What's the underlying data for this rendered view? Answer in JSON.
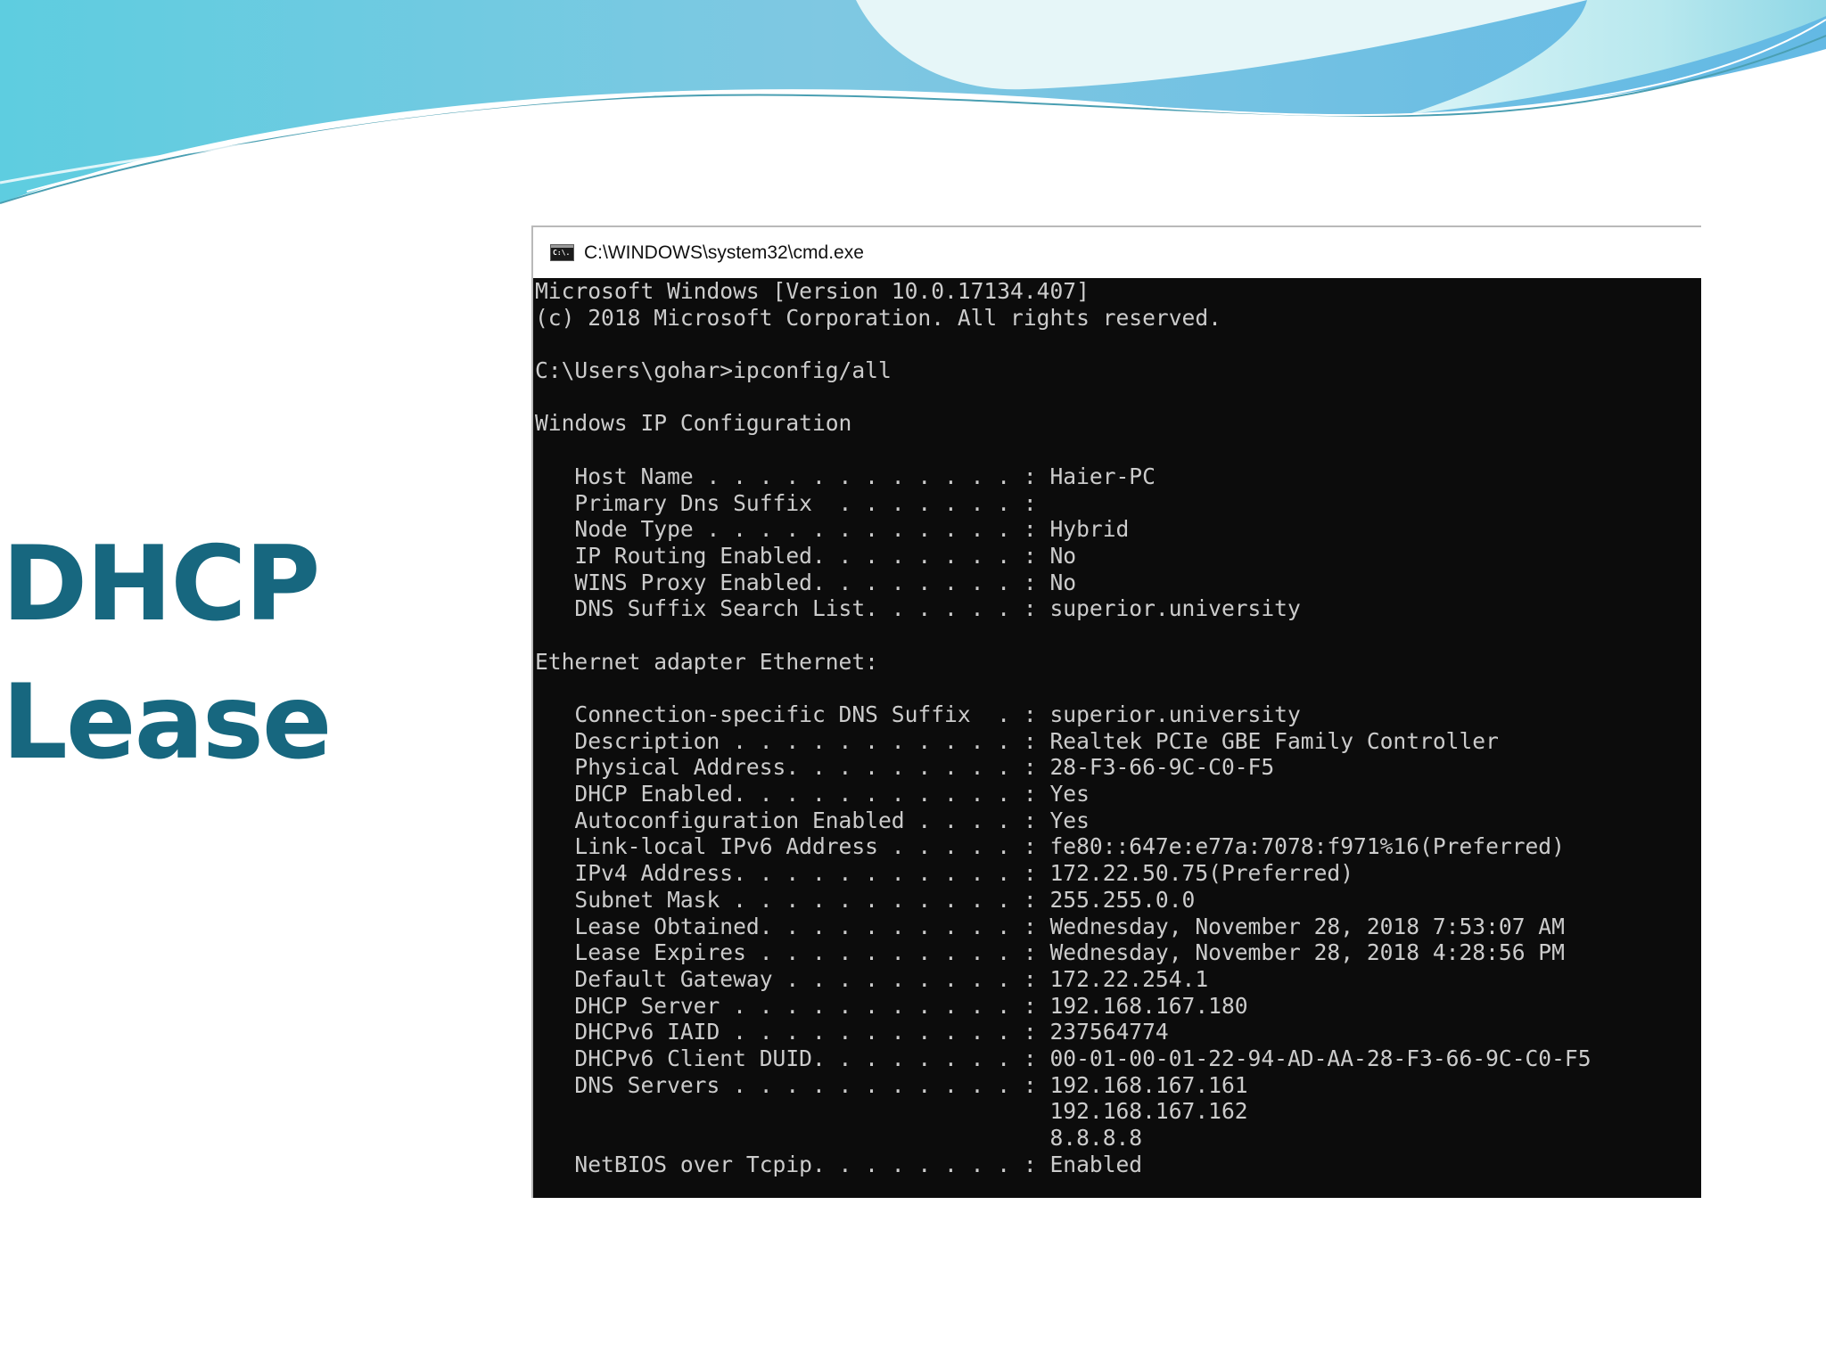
{
  "slide": {
    "title_line_1": "DHCP",
    "title_line_2": "Lease",
    "title_color": "#17677f"
  },
  "window": {
    "icon": "cmd-icon",
    "icon_text": "C:\\.",
    "title": "C:\\WINDOWS\\system32\\cmd.exe",
    "console_background": "#0c0c0c",
    "console_text_color": "#cccccc"
  },
  "console": {
    "lines": [
      "Microsoft Windows [Version 10.0.17134.407]",
      "(c) 2018 Microsoft Corporation. All rights reserved.",
      "",
      "C:\\Users\\gohar>ipconfig/all",
      "",
      "Windows IP Configuration",
      "",
      "   Host Name . . . . . . . . . . . . : Haier-PC",
      "   Primary Dns Suffix  . . . . . . . :",
      "   Node Type . . . . . . . . . . . . : Hybrid",
      "   IP Routing Enabled. . . . . . . . : No",
      "   WINS Proxy Enabled. . . . . . . . : No",
      "   DNS Suffix Search List. . . . . . : superior.university",
      "",
      "Ethernet adapter Ethernet:",
      "",
      "   Connection-specific DNS Suffix  . : superior.university",
      "   Description . . . . . . . . . . . : Realtek PCIe GBE Family Controller",
      "   Physical Address. . . . . . . . . : 28-F3-66-9C-C0-F5",
      "   DHCP Enabled. . . . . . . . . . . : Yes",
      "   Autoconfiguration Enabled . . . . : Yes",
      "   Link-local IPv6 Address . . . . . : fe80::647e:e77a:7078:f971%16(Preferred)",
      "   IPv4 Address. . . . . . . . . . . : 172.22.50.75(Preferred)",
      "   Subnet Mask . . . . . . . . . . . : 255.255.0.0",
      "   Lease Obtained. . . . . . . . . . : Wednesday, November 28, 2018 7:53:07 AM",
      "   Lease Expires . . . . . . . . . . : Wednesday, November 28, 2018 4:28:56 PM",
      "   Default Gateway . . . . . . . . . : 172.22.254.1",
      "   DHCP Server . . . . . . . . . . . : 192.168.167.180",
      "   DHCPv6 IAID . . . . . . . . . . . : 237564774",
      "   DHCPv6 Client DUID. . . . . . . . : 00-01-00-01-22-94-AD-AA-28-F3-66-9C-C0-F5",
      "   DNS Servers . . . . . . . . . . . : 192.168.167.161",
      "                                       192.168.167.162",
      "                                       8.8.8.8",
      "   NetBIOS over Tcpip. . . . . . . . : Enabled"
    ]
  }
}
